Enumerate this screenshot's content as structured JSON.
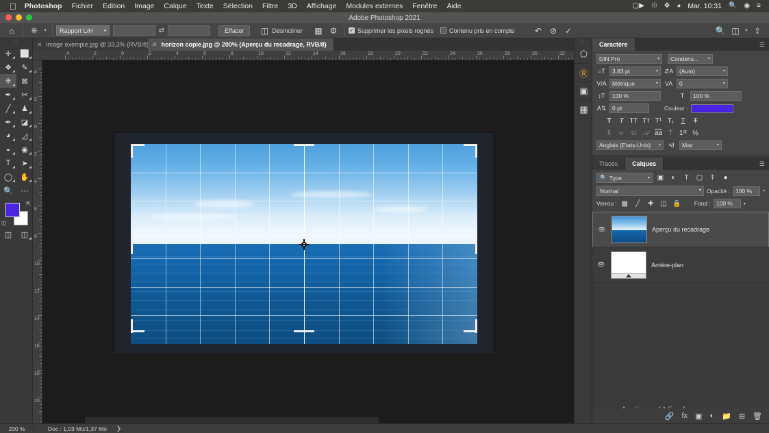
{
  "macos": {
    "apple_icon": "apple-icon",
    "menus": [
      "Photoshop",
      "Fichier",
      "Edition",
      "Image",
      "Calque",
      "Texte",
      "Sélection",
      "Filtre",
      "3D",
      "Affichage",
      "Modules externes",
      "Fenêtre",
      "Aide"
    ],
    "status_icons": [
      "screen-record-icon",
      "creative-cloud-icon",
      "dropbox-icon",
      "wifi-icon"
    ],
    "clock": "Mar. 10:31",
    "right_icons": [
      "search-icon",
      "siri-icon",
      "control-center-icon"
    ]
  },
  "window": {
    "title": "Adobe Photoshop 2021"
  },
  "options_bar": {
    "home_icon": "home-icon",
    "tool_icon": "crop-tool-icon",
    "ratio_label": "Rapport L/H",
    "width_value": "",
    "height_value": "",
    "swap_icon": "swap-dimensions-icon",
    "clear_label": "Effacer",
    "straighten_icon": "straighten-icon",
    "straighten_label": "Désincliner",
    "overlay_icon": "grid-overlay-icon",
    "settings_icon": "gear-icon",
    "delete_pixels_label": "Supprimer les pixels rognés",
    "delete_pixels_checked": true,
    "content_aware_label": "Contenu pris en compte",
    "content_aware_checked": false,
    "reset_icon": "reset-icon",
    "cancel_icon": "cancel-icon",
    "commit_icon": "commit-check-icon",
    "search_icon": "search-icon",
    "workspace_icon": "workspace-icon",
    "share_icon": "share-icon"
  },
  "tabs": [
    {
      "title": "image exemple.jpg @ 33,3% (RVB/8)",
      "active": false
    },
    {
      "title": "horizon copie.jpg @ 200% (Aperçu du recadrage, RVB/8)",
      "active": true
    }
  ],
  "toolbar": {
    "tools": [
      {
        "name": "move-tool",
        "glyph": "✛",
        "active": false
      },
      {
        "name": "rectangular-marquee-tool",
        "glyph": "▭",
        "active": false
      },
      {
        "name": "lasso-tool",
        "glyph": "𝒫",
        "active": false
      },
      {
        "name": "quick-selection-tool",
        "glyph": "✎",
        "active": false
      },
      {
        "name": "crop-tool",
        "glyph": "⌗",
        "active": true
      },
      {
        "name": "frame-tool",
        "glyph": "⊠",
        "active": false
      },
      {
        "name": "eyedropper-tool",
        "glyph": "✒",
        "active": false
      },
      {
        "name": "spot-healing-brush-tool",
        "glyph": "✚",
        "active": false
      },
      {
        "name": "brush-tool",
        "glyph": "🖌",
        "active": false
      },
      {
        "name": "clone-stamp-tool",
        "glyph": "♟",
        "active": false
      },
      {
        "name": "history-brush-tool",
        "glyph": "✐",
        "active": false
      },
      {
        "name": "eraser-tool",
        "glyph": "◧",
        "active": false
      },
      {
        "name": "gradient-tool",
        "glyph": "◐",
        "active": false
      },
      {
        "name": "blur-tool",
        "glyph": "💧",
        "active": false
      },
      {
        "name": "dodge-tool",
        "glyph": "◖",
        "active": false
      },
      {
        "name": "pen-tool",
        "glyph": "✐",
        "active": false
      },
      {
        "name": "type-tool",
        "glyph": "T",
        "active": false
      },
      {
        "name": "path-selection-tool",
        "glyph": "➤",
        "active": false
      },
      {
        "name": "shape-tool",
        "glyph": "◯",
        "active": false
      },
      {
        "name": "hand-tool",
        "glyph": "✋",
        "active": false
      },
      {
        "name": "zoom-tool",
        "glyph": "🔍",
        "active": false
      },
      {
        "name": "edit-toolbar-tool",
        "glyph": "⋯",
        "active": false
      }
    ],
    "foreground_color": "#4a24e0",
    "background_color": "#ffffff",
    "swap_colors_icon": "swap-colors-icon",
    "default_colors_icon": "default-colors-icon",
    "quick_mask_icon": "quick-mask-icon",
    "screen_mode_icon": "screen-mode-icon"
  },
  "rulers": {
    "horizontal": [
      "4",
      "2",
      "0",
      "2",
      "4",
      "6",
      "8",
      "10",
      "12",
      "14",
      "16",
      "18",
      "20",
      "22",
      "24",
      "26",
      "28",
      "30",
      "32"
    ],
    "vertical": [
      "4",
      "2",
      "0",
      "2",
      "4",
      "6",
      "8",
      "10",
      "12",
      "14",
      "16",
      "18",
      "20"
    ]
  },
  "dock_rail": [
    {
      "name": "3d-panel-icon",
      "glyph": "⬡"
    },
    {
      "name": "camera-raw-icon",
      "glyph": "Ⓡ"
    },
    {
      "name": "adjustments-panel-icon",
      "glyph": "◨"
    },
    {
      "name": "libraries-panel-icon",
      "glyph": "▦"
    }
  ],
  "character_panel": {
    "tab_label": "Caractère",
    "menu_icon": "panel-menu-icon",
    "font_family": "DIN Pro",
    "font_style": "Condens...",
    "size_icon": "font-size-icon",
    "size_value": "3,83 pt",
    "leading_icon": "leading-icon",
    "leading_value": "(Auto)",
    "kerning_icon": "kerning-icon",
    "kerning_value": "Métrique",
    "tracking_icon": "tracking-icon",
    "tracking_value": "0",
    "vscale_icon": "vertical-scale-icon",
    "vscale_value": "100 %",
    "hscale_icon": "horizontal-scale-icon",
    "hscale_value": "100 %",
    "baseline_icon": "baseline-shift-icon",
    "baseline_value": "0 pt",
    "color_label": "Couleur :",
    "color_value": "#4a24e0",
    "style_glyphs": [
      "T",
      "T",
      "TT",
      "Tr",
      "T¹",
      "T₁",
      "T̲",
      "T̶"
    ],
    "opentype_glyphs": [
      "fi",
      "ᵳ",
      "st",
      "𝒜",
      "aa",
      "T",
      "1ˢᵗ",
      "½"
    ],
    "language": "Anglais (Etats-Unis)",
    "antialias_icon": "antialias-icon",
    "antialias_value": "Mac"
  },
  "layers_panel": {
    "tabs": [
      {
        "label": "Tracés",
        "active": false
      },
      {
        "label": "Calques",
        "active": true
      }
    ],
    "menu_icon": "panel-menu-icon",
    "filter_icon": "search-icon",
    "filter_label": "Type",
    "filter_kind_icons": [
      "pixel-filter-icon",
      "adjustment-filter-icon",
      "type-filter-icon",
      "shape-filter-icon",
      "smart-object-filter-icon"
    ],
    "filter_toggle_icon": "filter-toggle-icon",
    "blend_mode": "Normal",
    "opacity_label": "Opacité :",
    "opacity_value": "100 %",
    "lock_label": "Verrou :",
    "lock_icons": [
      "lock-transparency-icon",
      "lock-pixels-icon",
      "lock-position-icon",
      "lock-artboard-icon",
      "lock-all-icon"
    ],
    "fill_label": "Fond :",
    "fill_value": "100 %",
    "layers": [
      {
        "name": "Aperçu du recadrage",
        "visible": true,
        "selected": true,
        "thumb": "photo"
      },
      {
        "name": "Arrière-plan",
        "visible": true,
        "selected": false,
        "thumb": "white"
      }
    ],
    "footer_icons": [
      "link-layers-icon",
      "layer-style-icon",
      "layer-mask-icon",
      "adjustment-layer-icon",
      "new-group-icon",
      "new-layer-icon",
      "delete-layer-icon"
    ]
  },
  "watermark": {
    "text": "Activer Windows"
  },
  "status_bar": {
    "zoom": "200 %",
    "doc_info": "Doc : 1,03 Mo/1,37 Mo",
    "arrow": "❯"
  },
  "canvas": {
    "crop_overlay": "grid-overlay",
    "grid_columns": 10,
    "grid_rows": 7,
    "center_marker": "crop-center-marker"
  }
}
